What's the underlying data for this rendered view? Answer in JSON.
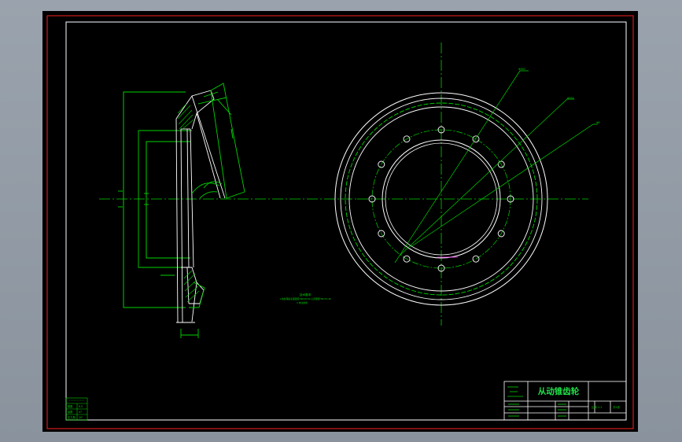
{
  "drawing": {
    "title": "从动锥齿轮",
    "colors": {
      "background": "#000000",
      "outer_border": "#d01a1a",
      "line_white": "#ffffff",
      "line_green": "#00d200",
      "title_green": "#21e04a",
      "magenta": "#ff33ff",
      "workspace": "#9aa3ad"
    },
    "params_table": {
      "rows": [
        {
          "label": "模数",
          "value": "6.5"
        },
        {
          "label": "齿数",
          "value": "47"
        },
        {
          "label": "压力角",
          "value": "20°"
        }
      ]
    },
    "tech_notes": {
      "heading": "技术要求",
      "line1": "1.热处理后表面硬度HRC58-62,心部硬度HRC33-48",
      "line2": "2.未注倒角"
    },
    "title_block": {
      "scale": "比例 1:1",
      "sheet": "共1张"
    },
    "callouts": {
      "c1": "Φ390",
      "c2": "Φ330",
      "c3": "Φ8"
    }
  }
}
